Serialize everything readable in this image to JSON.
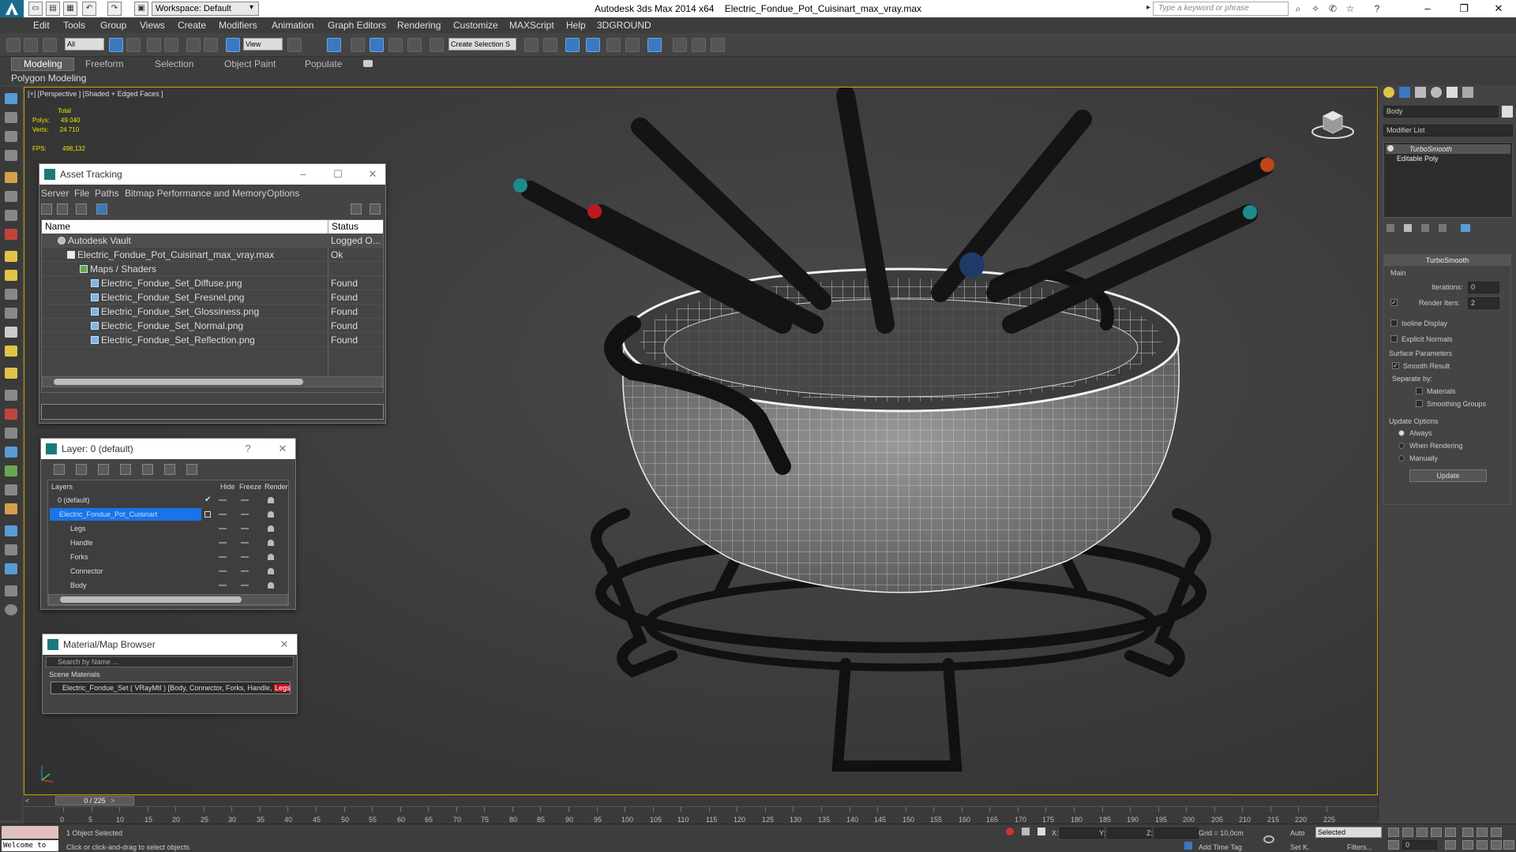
{
  "titlebar": {
    "workspace": "Workspace: Default",
    "app": "Autodesk 3ds Max  2014 x64",
    "file": "Electric_Fondue_Pot_Cuisinart_max_vray.max",
    "search_placeholder": "Type a keyword or phrase"
  },
  "menu": [
    "Edit",
    "Tools",
    "Group",
    "Views",
    "Create",
    "Modifiers",
    "Animation",
    "Graph Editors",
    "Rendering",
    "Customize",
    "MAXScript",
    "Help",
    "3DGROUND"
  ],
  "toolbar": {
    "selection_filter": "All",
    "ref_coord": "View",
    "named_selection": "Create Selection S"
  },
  "ribbon": {
    "tabs": [
      "Modeling",
      "Freeform",
      "Selection",
      "Object Paint",
      "Populate"
    ],
    "sub_label": "Polygon Modeling"
  },
  "viewport": {
    "label": "[+] [Perspective ] [Shaded + Edged Faces ]",
    "stats_total": "Total",
    "polys_label": "Polys:",
    "polys_value": "49 040",
    "verts_label": "Verts:",
    "verts_value": "24 710",
    "fps_label": "FPS:",
    "fps_value": "498,132"
  },
  "asset_tracking": {
    "title": "Asset Tracking",
    "menu": [
      "Server",
      "File",
      "Paths",
      "Bitmap Performance and Memory",
      "Options"
    ],
    "col_name": "Name",
    "col_status": "Status",
    "rows": [
      {
        "name": "Autodesk Vault",
        "status": "Logged O..."
      },
      {
        "name": "Electric_Fondue_Pot_Cuisinart_max_vray.max",
        "status": "Ok"
      },
      {
        "name": "Maps / Shaders",
        "status": ""
      },
      {
        "name": "Electric_Fondue_Set_Diffuse.png",
        "status": "Found"
      },
      {
        "name": "Electric_Fondue_Set_Fresnel.png",
        "status": "Found"
      },
      {
        "name": "Electric_Fondue_Set_Glossiness.png",
        "status": "Found"
      },
      {
        "name": "Electric_Fondue_Set_Normal.png",
        "status": "Found"
      },
      {
        "name": "Electric_Fondue_Set_Reflection.png",
        "status": "Found"
      }
    ]
  },
  "layer_manager": {
    "title": "Layer: 0 (default)",
    "help": "?",
    "col_layers": "Layers",
    "col_hide": "Hide",
    "col_freeze": "Freeze",
    "col_render": "Render",
    "rows": [
      "0 (default)",
      "Electric_Fondue_Pot_Cuisinart",
      "Legs",
      "Handle",
      "Forks",
      "Connector",
      "Body"
    ]
  },
  "material_browser": {
    "title": "Material/Map Browser",
    "search_placeholder": "Search by Name ...",
    "group": "Scene Materials",
    "item_prefix": "Electric_Fondue_Set ( VRayMtl ) [Body, Connector, Forks, Handle, ",
    "item_highlight": "Legs]"
  },
  "command_panel": {
    "object_name": "Body",
    "modifier_list": "Modifier List",
    "stack": [
      "TurboSmooth",
      "Editable Poly"
    ],
    "rollout_title": "TurboSmooth",
    "main_label": "Main",
    "iterations_label": "Iterations:",
    "iterations_value": "0",
    "render_iters_label": "Render Iters:",
    "render_iters_value": "2",
    "isoline": "Isoline Display",
    "explicit": "Explicit Normals",
    "surface_params": "Surface Parameters",
    "smooth_result": "Smooth Result",
    "separate_by": "Separate by:",
    "materials": "Materials",
    "smoothing_groups": "Smoothing Groups",
    "update_options": "Update Options",
    "always": "Always",
    "when_rendering": "When Rendering",
    "manually": "Manually",
    "update_btn": "Update"
  },
  "timeline": {
    "frame": "0 / 225",
    "ticks": [
      "0",
      "5",
      "10",
      "15",
      "20",
      "25",
      "30",
      "35",
      "40",
      "45",
      "50",
      "55",
      "60",
      "65",
      "70",
      "75",
      "80",
      "85",
      "90",
      "95",
      "100",
      "105",
      "110",
      "115",
      "120",
      "125",
      "130",
      "135",
      "140",
      "145",
      "150",
      "155",
      "160",
      "165",
      "170",
      "175",
      "180",
      "185",
      "190",
      "195",
      "200",
      "205",
      "210",
      "215",
      "220",
      "225"
    ]
  },
  "status": {
    "maxscript": "Welcome to",
    "selected": "1 Object Selected",
    "prompt": "Click or click-and-drag to select objects",
    "x": "X:",
    "y": "Y:",
    "z": "Z:",
    "grid": "Grid = 10,0cm",
    "add_time_tag": "Add Time Tag",
    "auto": "Auto",
    "selected_dd": "Selected",
    "setk": "Set K.",
    "filters": "Filters...",
    "frame_field": "0"
  }
}
